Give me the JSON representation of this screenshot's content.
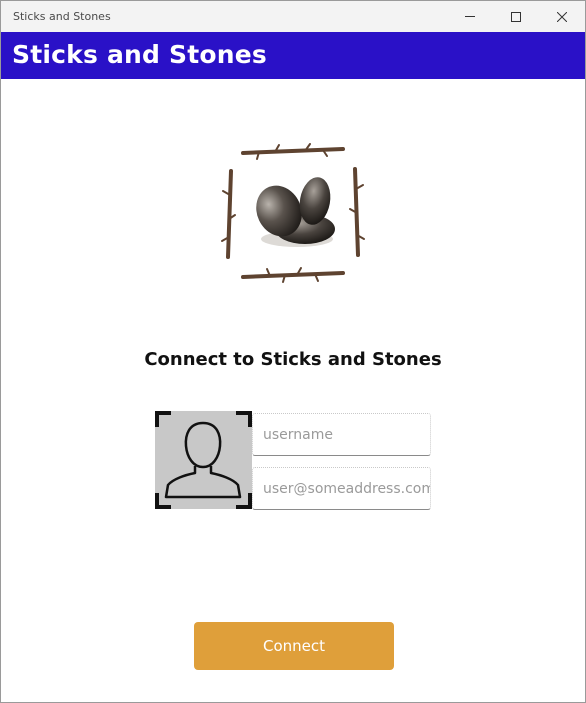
{
  "window": {
    "title": "Sticks and Stones",
    "controls": {
      "minimize": "minimize-icon",
      "maximize": "maximize-icon",
      "close": "close-icon"
    }
  },
  "header": {
    "title": "Sticks and Stones"
  },
  "logo": {
    "icon": "sticks-and-stones-logo"
  },
  "form": {
    "heading": "Connect to Sticks and Stones",
    "avatar_icon": "user-silhouette-icon",
    "username": {
      "value": "",
      "placeholder": "username"
    },
    "email": {
      "value": "",
      "placeholder": "user@someaddress.com"
    },
    "connect_label": "Connect"
  },
  "colors": {
    "header_bg": "#2a11c7",
    "button_bg": "#df9f3a",
    "avatar_bg": "#c8c8c8"
  }
}
